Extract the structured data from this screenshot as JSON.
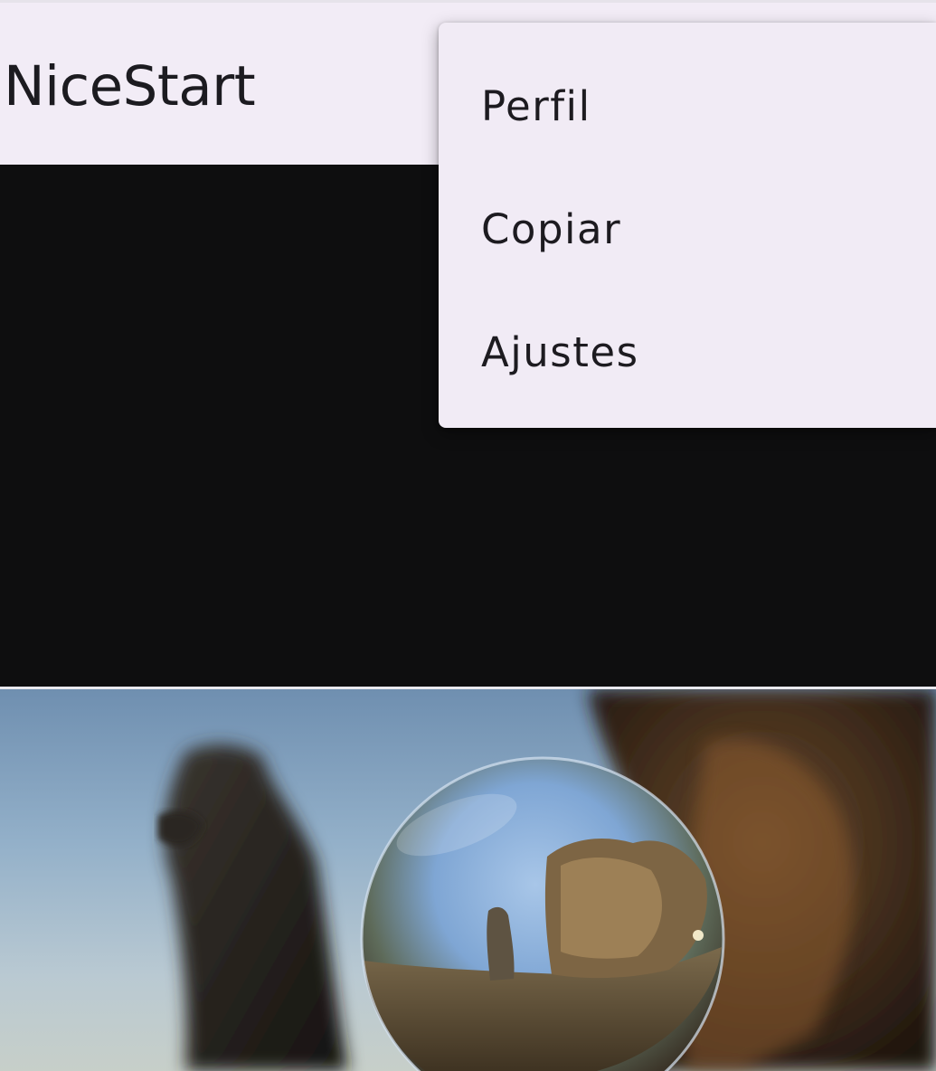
{
  "app_bar": {
    "title": "NiceStart"
  },
  "overflow_menu": {
    "items": [
      {
        "label": "Perfil"
      },
      {
        "label": "Copiar"
      },
      {
        "label": "Ajustes"
      }
    ]
  },
  "colors": {
    "app_bar_background": "#f2ecf6",
    "menu_background": "#f1ebf5",
    "content_background": "#0e0e0f",
    "text_primary": "#1c1b20"
  },
  "image": {
    "subject": "crystal-ball-rock-landscape"
  }
}
